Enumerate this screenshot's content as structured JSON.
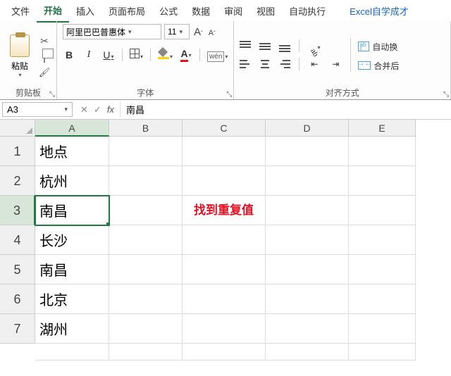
{
  "menu": {
    "items": [
      "文件",
      "开始",
      "插入",
      "页面布局",
      "公式",
      "数据",
      "审阅",
      "视图",
      "自动执行"
    ],
    "active_index": 1,
    "right_link": "Excel自学成才"
  },
  "ribbon": {
    "clipboard": {
      "paste": "粘贴",
      "label": "剪贴板"
    },
    "font": {
      "name": "阿里巴巴普惠体",
      "size": "11",
      "increase": "A",
      "decrease": "A",
      "bold": "B",
      "italic": "I",
      "underline": "U",
      "fontcolor_letter": "A",
      "wen": "wén",
      "label": "字体"
    },
    "align": {
      "wrap": "自动换",
      "merge": "合并后",
      "label": "对齐方式"
    }
  },
  "fx": {
    "namebox": "A3",
    "cancel": "✕",
    "confirm": "✓",
    "fx": "fx",
    "formula": "南昌"
  },
  "grid": {
    "cols": [
      "A",
      "B",
      "C",
      "D",
      "E"
    ],
    "sel_col": 0,
    "rows": [
      "1",
      "2",
      "3",
      "4",
      "5",
      "6",
      "7"
    ],
    "sel_row": 2,
    "colA": [
      "地点",
      "杭州",
      "南昌",
      "长沙",
      "南昌",
      "北京",
      "湖州"
    ],
    "c3": "找到重复值"
  }
}
